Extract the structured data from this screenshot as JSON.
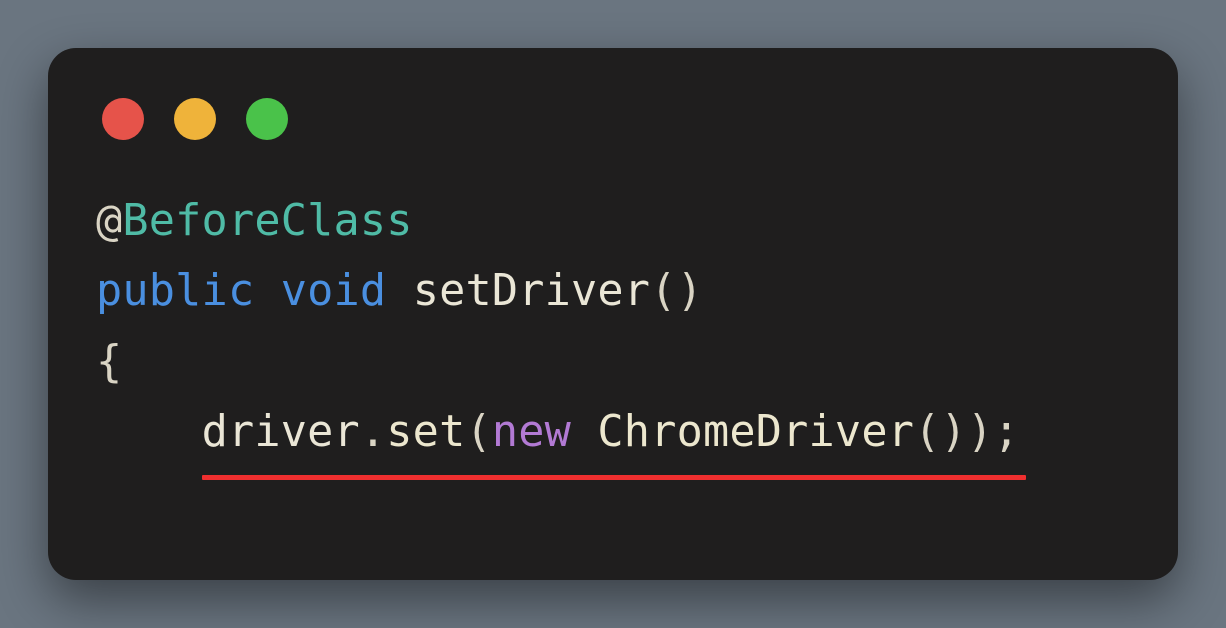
{
  "window": {
    "traffic_lights": [
      "red",
      "yellow",
      "green"
    ]
  },
  "code": {
    "line1": {
      "at": "@",
      "annotation": "BeforeClass"
    },
    "line2": {
      "kw_public": "public",
      "sp1": " ",
      "kw_void": "void",
      "sp2": " ",
      "method": "setDriver",
      "parens": "()"
    },
    "line3": {
      "brace": "{"
    },
    "line4": {
      "indent": "    ",
      "ident": "driver",
      "dot": ".",
      "call": "set",
      "open": "(",
      "kw_new": "new",
      "sp": " ",
      "type": "ChromeDriver",
      "ctor": "()",
      "close": ")",
      "semi": ";"
    }
  }
}
